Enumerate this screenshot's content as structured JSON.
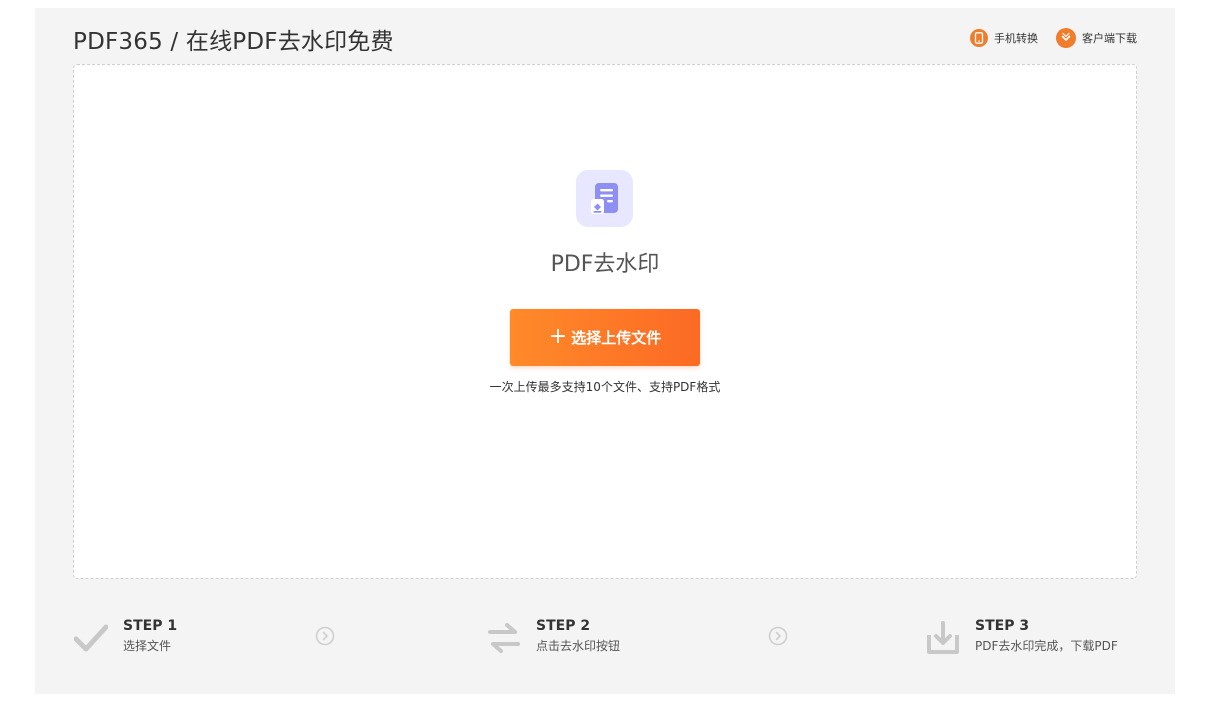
{
  "header": {
    "title": "PDF365 / 在线PDF去水印免费",
    "links": [
      {
        "label": "手机转换",
        "icon": "phone-icon"
      },
      {
        "label": "客户端下载",
        "icon": "download-client-icon"
      }
    ]
  },
  "upload": {
    "tool_name": "PDF去水印",
    "button_label": "选择上传文件",
    "hint": "一次上传最多支持10个文件、支持PDF格式"
  },
  "steps": [
    {
      "title": "STEP 1",
      "desc": "选择文件",
      "icon": "check-icon"
    },
    {
      "title": "STEP 2",
      "desc": "点击去水印按钮",
      "icon": "swap-arrows-icon"
    },
    {
      "title": "STEP 3",
      "desc": "PDF去水印完成，下载PDF",
      "icon": "download-tray-icon"
    }
  ],
  "colors": {
    "accent": "#fc7a2a",
    "panel_bg": "#f4f4f4",
    "icon_tile_bg": "#e7e8ff",
    "icon_tile_fg": "#8d8ff2",
    "step_icon": "#c8c8c8"
  }
}
